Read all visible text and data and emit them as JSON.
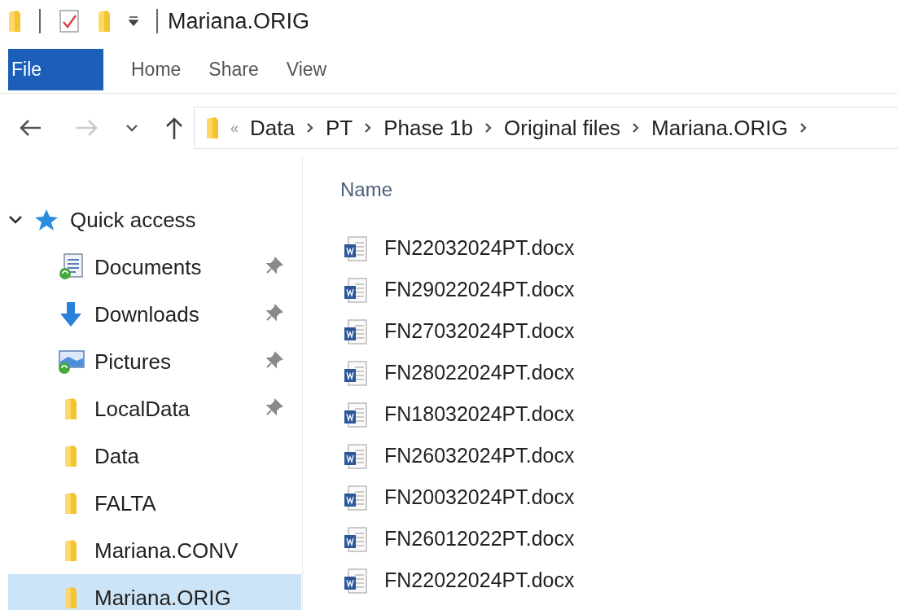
{
  "title_bar": {
    "title": "Mariana.ORIG"
  },
  "ribbon_tabs": [
    {
      "label": "File",
      "kind": "file"
    },
    {
      "label": "Home",
      "kind": "tab"
    },
    {
      "label": "Share",
      "kind": "tab"
    },
    {
      "label": "View",
      "kind": "tab"
    }
  ],
  "navigation": {
    "forward_disabled": true,
    "address": {
      "overflow": "«",
      "segments": [
        "Data",
        "PT",
        "Phase 1b",
        "Original files",
        "Mariana.ORIG"
      ]
    }
  },
  "sidebar": {
    "items": [
      {
        "label": "Quick access",
        "kind": "star",
        "expanded": true,
        "selected": false,
        "children": [
          {
            "label": "Documents",
            "kind": "documents",
            "pinned": true,
            "selected": false
          },
          {
            "label": "Downloads",
            "kind": "downloads",
            "pinned": true,
            "selected": false
          },
          {
            "label": "Pictures",
            "kind": "pictures",
            "pinned": true,
            "selected": false
          },
          {
            "label": "LocalData",
            "kind": "folder",
            "pinned": true,
            "selected": false
          },
          {
            "label": "Data",
            "kind": "folder",
            "pinned": false,
            "selected": false
          },
          {
            "label": "FALTA",
            "kind": "folder",
            "pinned": false,
            "selected": false
          },
          {
            "label": "Mariana.CONV",
            "kind": "folder",
            "pinned": false,
            "selected": false
          },
          {
            "label": "Mariana.ORIG",
            "kind": "folder",
            "pinned": false,
            "selected": true
          }
        ]
      }
    ]
  },
  "file_list": {
    "columns": [
      "Name"
    ],
    "rows": [
      {
        "name": "FN22032024PT.docx"
      },
      {
        "name": "FN29022024PT.docx"
      },
      {
        "name": "FN27032024PT.docx"
      },
      {
        "name": "FN28022024PT.docx"
      },
      {
        "name": "FN18032024PT.docx"
      },
      {
        "name": "FN26032024PT.docx"
      },
      {
        "name": "FN20032024PT.docx"
      },
      {
        "name": "FN26012022PT.docx"
      },
      {
        "name": "FN22022024PT.docx"
      }
    ]
  }
}
